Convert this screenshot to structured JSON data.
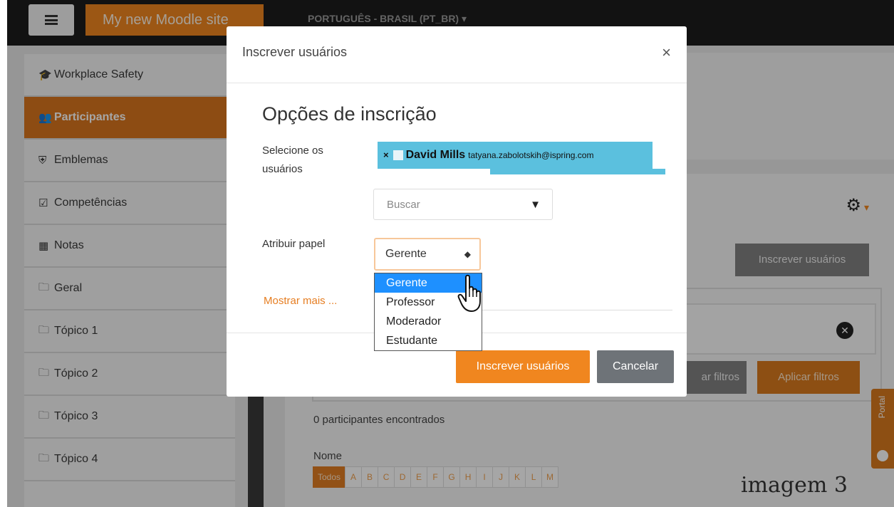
{
  "header": {
    "brand": "My new Moodle site",
    "language": "PORTUGUÊS - BRASIL (PT_BR) ▾"
  },
  "sidebar": {
    "items": [
      {
        "label": "Workplace Safety",
        "icon": "graduation-cap-icon",
        "glyph": "🎓"
      },
      {
        "label": "Participantes",
        "icon": "users-icon",
        "glyph": "👥",
        "active": true
      },
      {
        "label": "Emblemas",
        "icon": "shield-icon",
        "glyph": "⛨"
      },
      {
        "label": "Competências",
        "icon": "checkbox-icon",
        "glyph": "☑"
      },
      {
        "label": "Notas",
        "icon": "table-icon",
        "glyph": "▦"
      },
      {
        "label": "Geral",
        "icon": "folder-icon",
        "glyph": "🗀"
      },
      {
        "label": "Tópico 1",
        "icon": "folder-icon",
        "glyph": "🗀"
      },
      {
        "label": "Tópico 2",
        "icon": "folder-icon",
        "glyph": "🗀"
      },
      {
        "label": "Tópico 3",
        "icon": "folder-icon",
        "glyph": "🗀"
      },
      {
        "label": "Tópico 4",
        "icon": "folder-icon",
        "glyph": "🗀"
      }
    ]
  },
  "main": {
    "enroll_button": "Inscrever usuários",
    "clear_filters": "ar filtros",
    "apply_filters": "Aplicar filtros",
    "participants_count": "0 participantes encontrados",
    "name_label": "Nome",
    "letters": [
      "Todos",
      "A",
      "B",
      "C",
      "D",
      "E",
      "F",
      "G",
      "H",
      "I",
      "J",
      "K",
      "L",
      "M"
    ],
    "portal_label": "Portal"
  },
  "modal": {
    "title": "Inscrever usuários",
    "close": "×",
    "section_title": "Opções de inscrição",
    "select_users_label": "Selecione os usuários",
    "selected_user": {
      "remove": "×",
      "name": "David Mills",
      "email": "tatyana.zabolotskih@ispring.com"
    },
    "search_placeholder": "Buscar",
    "search_caret": "▼",
    "assign_role_label": "Atribuir papel",
    "role_value": "Gerente",
    "role_caret": "◆",
    "show_more": "Mostrar mais ...",
    "role_options": [
      "Gerente",
      "Professor",
      "Moderador",
      "Estudante"
    ],
    "submit": "Inscrever usuários",
    "cancel": "Cancelar"
  },
  "watermark": "imagem 3",
  "colors": {
    "accent": "#f0861f",
    "selected_chip": "#5bc0de",
    "option_highlight": "#1e90ff"
  }
}
